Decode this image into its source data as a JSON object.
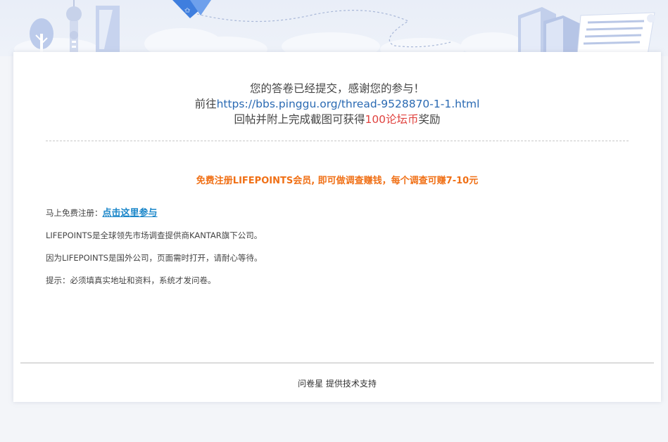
{
  "message": {
    "submitted": "您的答卷已经提交，感谢您的参与！",
    "goto_prefix": "前往",
    "goto_link": "https://bbs.pinggu.org/thread-9528870-1-1.html",
    "reward_prefix": "回帖并附上完成截图可获得",
    "reward_amount": "100论坛币",
    "reward_suffix": "奖励"
  },
  "promo": {
    "headline": "免费注册LIFEPOINTS会员, 即可做调查赚钱，每个调查可赚7-10元",
    "register_prefix": "马上免费注册：",
    "register_link": "点击这里参与",
    "about": "LIFEPOINTS是全球领先市场调查提供商KANTAR旗下公司。",
    "notice": "因为LIFEPOINTS是国外公司，页面需时打开，请耐心等待。",
    "tip": "提示：必须填真实地址和资料，系统才发问卷。"
  },
  "footer": {
    "brand": "问卷星",
    "support": "提供技术支持"
  },
  "colors": {
    "link": "#2a6ab3",
    "reward": "#e0433f",
    "promo": "#f07016",
    "register_link": "#1a86c9"
  }
}
